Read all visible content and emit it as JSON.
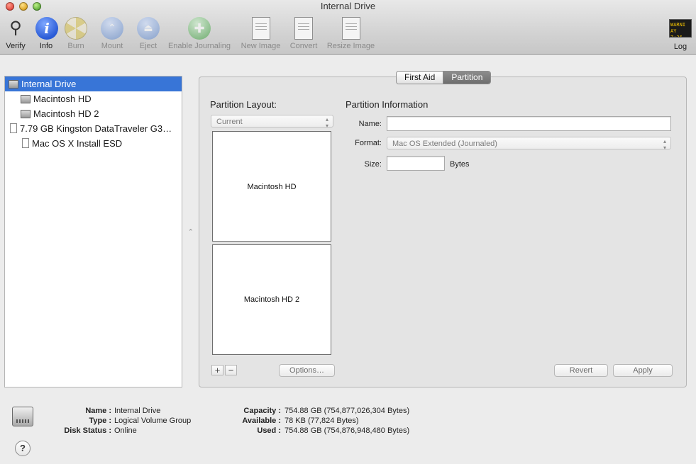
{
  "window": {
    "title": "Internal Drive"
  },
  "toolbar": {
    "verify": "Verify",
    "info": "Info",
    "burn": "Burn",
    "mount": "Mount",
    "eject": "Eject",
    "enable_journaling": "Enable Journaling",
    "new_image": "New Image",
    "convert": "Convert",
    "resize_image": "Resize Image",
    "log": "Log",
    "log_screen_line1": "WARNI",
    "log_screen_line2": "AY 7:36"
  },
  "sidebar": {
    "items": [
      {
        "label": "Internal Drive"
      },
      {
        "label": "Macintosh HD"
      },
      {
        "label": "Macintosh HD 2"
      },
      {
        "label": "7.79 GB Kingston DataTraveler G3…"
      },
      {
        "label": "Mac OS X Install ESD"
      }
    ]
  },
  "tabs": {
    "first_aid": "First Aid",
    "partition": "Partition"
  },
  "partition": {
    "layout_title": "Partition Layout:",
    "layout_select": "Current",
    "volumes": [
      "Macintosh HD",
      "Macintosh HD 2"
    ],
    "add": "+",
    "remove": "−",
    "options": "Options…",
    "info_title": "Partition Information",
    "name_label": "Name:",
    "name_value": "",
    "format_label": "Format:",
    "format_value": "Mac OS Extended (Journaled)",
    "size_label": "Size:",
    "size_value": "",
    "size_unit": "Bytes",
    "revert": "Revert",
    "apply": "Apply"
  },
  "details": {
    "name_key": "Name :",
    "name_val": "Internal Drive",
    "type_key": "Type :",
    "type_val": "Logical Volume Group",
    "status_key": "Disk Status :",
    "status_val": "Online",
    "capacity_key": "Capacity :",
    "capacity_val": "754.88 GB (754,877,026,304 Bytes)",
    "available_key": "Available :",
    "available_val": "78 KB (77,824 Bytes)",
    "used_key": "Used :",
    "used_val": "754.88 GB (754,876,948,480 Bytes)"
  },
  "help": "?"
}
